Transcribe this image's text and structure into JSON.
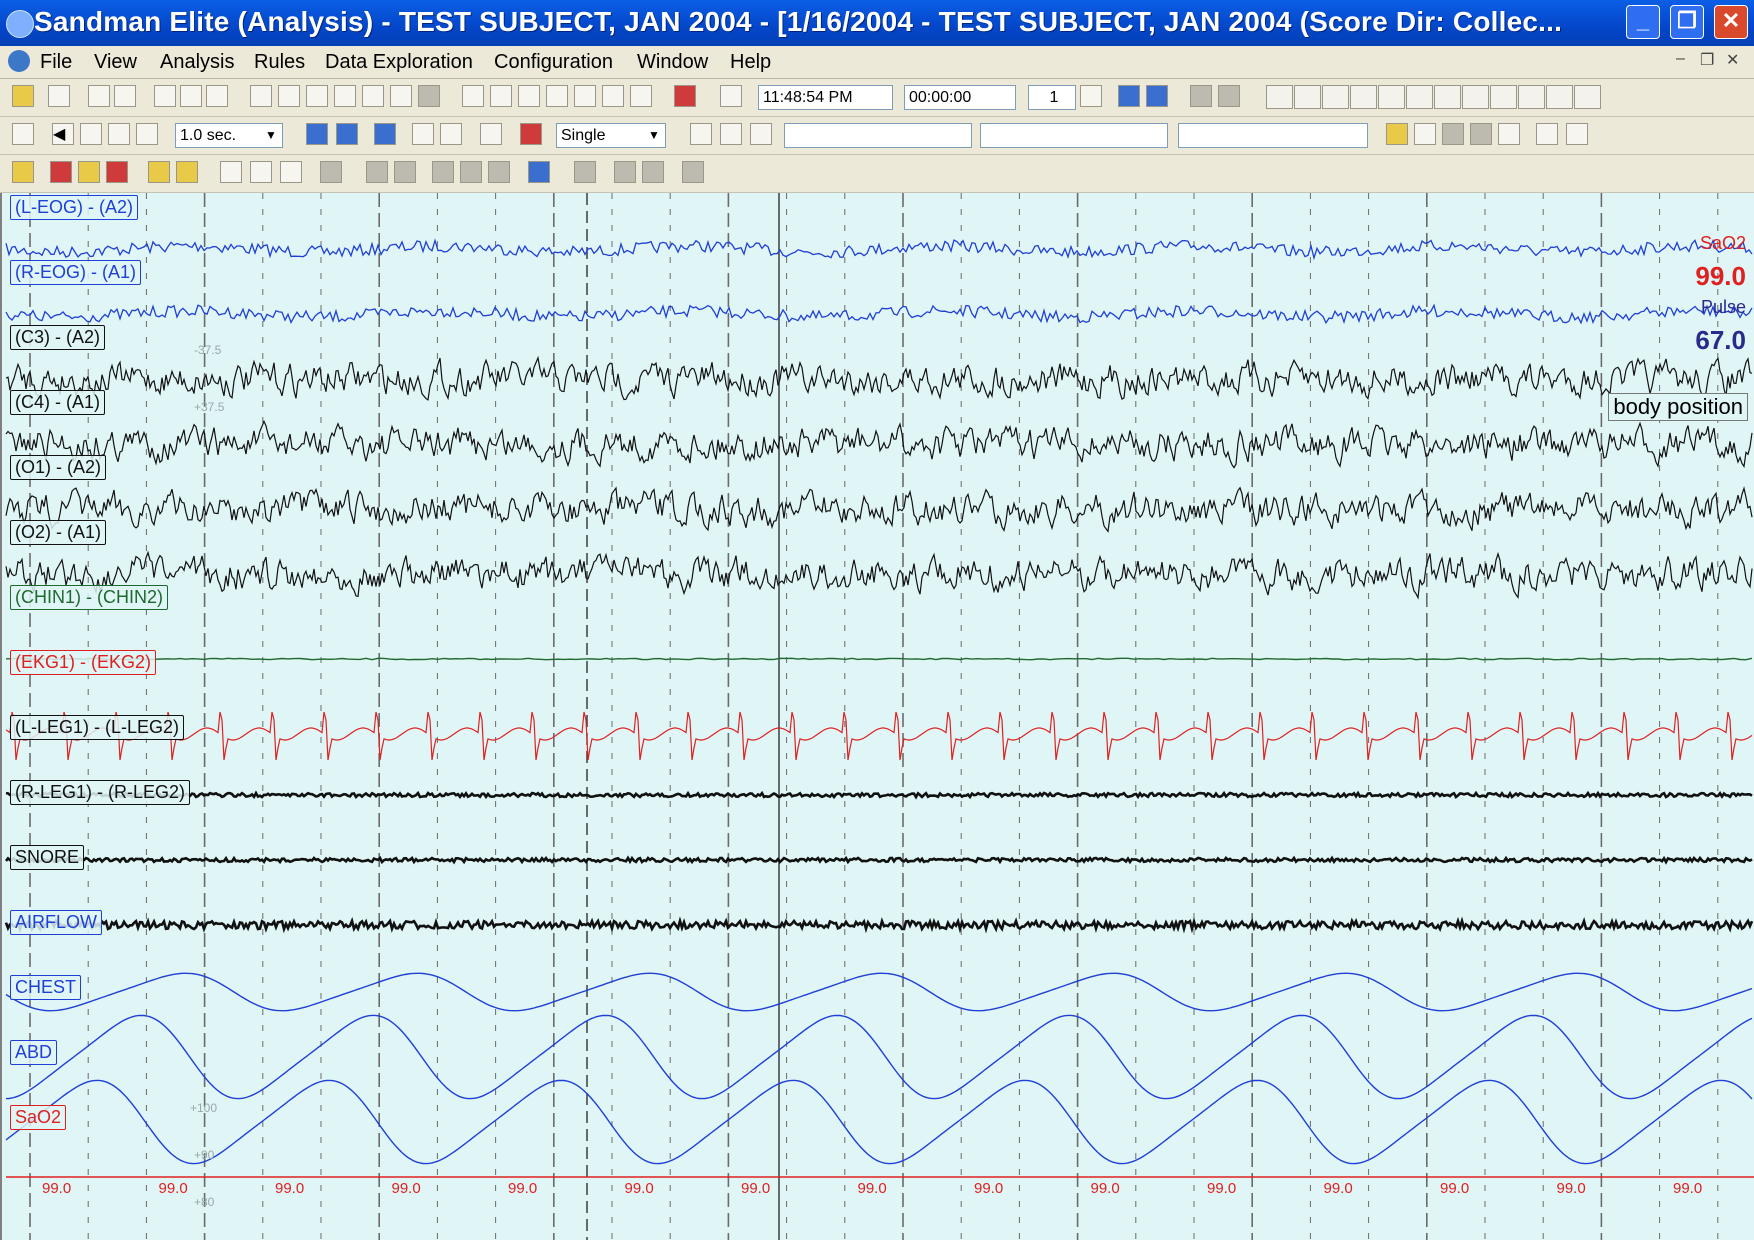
{
  "window": {
    "title": "Sandman Elite (Analysis) - TEST SUBJECT, JAN 2004 - [1/16/2004 - TEST SUBJECT, JAN 2004 (Score Dir: Collec..."
  },
  "menu": [
    "File",
    "View",
    "Analysis",
    "Rules",
    "Data Exploration",
    "Configuration",
    "Window",
    "Help"
  ],
  "toolbar": {
    "time": "11:48:54 PM",
    "elapsed": "00:00:00",
    "page": "1",
    "speed": "1.0 sec.",
    "mode": "Single"
  },
  "channels": [
    {
      "label": "(L-EOG) - (A2)",
      "color": "#1f3fd6",
      "type": "eog"
    },
    {
      "label": "(R-EOG) - (A1)",
      "color": "#1f3fd6",
      "type": "eog"
    },
    {
      "label": "(C3) - (A2)",
      "color": "#111111",
      "type": "eeg"
    },
    {
      "label": "(C4) - (A1)",
      "color": "#111111",
      "type": "eeg"
    },
    {
      "label": "(O1) - (A2)",
      "color": "#111111",
      "type": "eeg"
    },
    {
      "label": "(O2) - (A1)",
      "color": "#111111",
      "type": "eeg"
    },
    {
      "label": "(CHIN1) - (CHIN2)",
      "color": "#1e6a2e",
      "type": "flat"
    },
    {
      "label": "(EKG1) - (EKG2)",
      "color": "#e02020",
      "type": "ekg"
    },
    {
      "label": "(L-LEG1) - (L-LEG2)",
      "color": "#111111",
      "type": "thick"
    },
    {
      "label": "(R-LEG1) - (R-LEG2)",
      "color": "#111111",
      "type": "thick"
    },
    {
      "label": "SNORE",
      "color": "#111111",
      "type": "thick"
    },
    {
      "label": "AIRFLOW",
      "color": "#1f3fd6",
      "type": "airflow"
    },
    {
      "label": "CHEST",
      "color": "#1f3fd6",
      "type": "chest"
    },
    {
      "label": "ABD",
      "color": "#1f3fd6",
      "type": "abd"
    },
    {
      "label": "SaO2",
      "color": "#e02020",
      "type": "sao2"
    }
  ],
  "scale_labels": [
    "-37.5",
    "+37.5",
    "+100",
    "+90",
    "+80"
  ],
  "readouts": {
    "sao2_label": "SaO2",
    "sao2_value": "99.0",
    "pulse_label": "Pulse",
    "pulse_value": "67.0",
    "body_position": "body position"
  },
  "sao2_trace_value": "99.0",
  "colors": {
    "background": "#dff5f6",
    "grid": "#6b6b6b",
    "blue": "#1f3fd6",
    "red": "#e02020"
  }
}
